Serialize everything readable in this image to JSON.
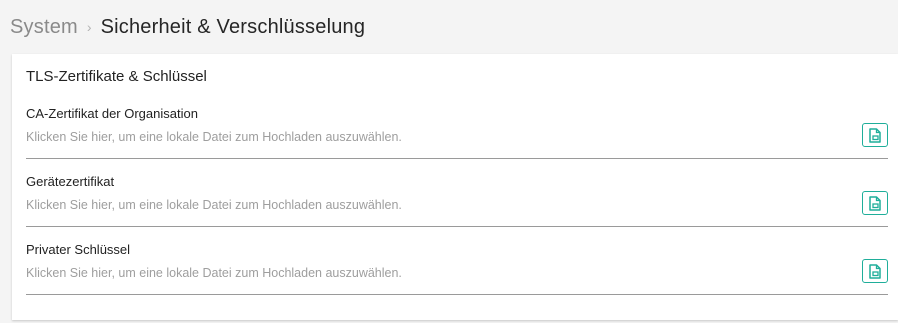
{
  "breadcrumb": {
    "parent": "System",
    "separator": "›",
    "current": "Sicherheit & Verschlüsselung"
  },
  "card": {
    "title": "TLS-Zertifikate & Schlüssel",
    "fields": [
      {
        "label": "CA-Zertifikat der Organisation",
        "placeholder": "Klicken Sie hier, um eine lokale Datei zum Hochladen auszuwählen.",
        "button_icon": "file-upload-icon"
      },
      {
        "label": "Gerätezertifikat",
        "placeholder": "Klicken Sie hier, um eine lokale Datei zum Hochladen auszuwählen.",
        "button_icon": "file-upload-icon"
      },
      {
        "label": "Privater Schlüssel",
        "placeholder": "Klicken Sie hier, um eine lokale Datei zum Hochladen auszuwählen.",
        "button_icon": "file-upload-icon"
      }
    ]
  },
  "colors": {
    "accent": "#1fae9a",
    "background": "#f4f4f4",
    "card": "#ffffff",
    "placeholder": "#9e9e9e"
  }
}
